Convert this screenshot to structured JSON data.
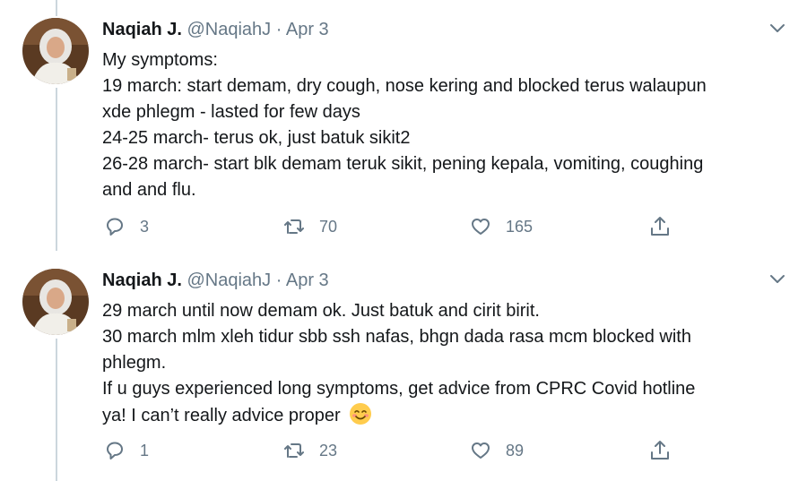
{
  "tweets": [
    {
      "name": "Naqiah J.",
      "handle": "@NaqiahJ",
      "separator": "·",
      "date": "Apr 3",
      "lines": [
        "My symptoms:",
        "19 march: start demam, dry cough, nose kering and blocked terus walaupun",
        "xde phlegm - lasted for few days",
        "24-25 march- terus ok, just batuk sikit2",
        "26-28 march- start blk demam teruk sikit, pening kepala, vomiting, coughing",
        "and and flu."
      ],
      "replies": "3",
      "retweets": "70",
      "likes": "165"
    },
    {
      "name": "Naqiah J.",
      "handle": "@NaqiahJ",
      "separator": "·",
      "date": "Apr 3",
      "lines": [
        "29 march until now demam ok. Just batuk and cirit birit.",
        "30 march mlm xleh tidur sbb ssh nafas, bhgn dada rasa mcm blocked with",
        "phlegm.",
        "If u guys experienced long symptoms, get advice from CPRC Covid hotline",
        "ya! I can’t really advice proper"
      ],
      "emoji": "smiling-face-with-smiling-eyes",
      "replies": "1",
      "retweets": "23",
      "likes": "89"
    }
  ],
  "icons": {
    "reply": "reply-icon",
    "retweet": "retweet-icon",
    "like": "heart-icon",
    "share": "share-icon",
    "more": "chevron-down-icon"
  },
  "colors": {
    "text": "#14171a",
    "muted": "#657786",
    "thread_line": "#ccd6dd"
  }
}
